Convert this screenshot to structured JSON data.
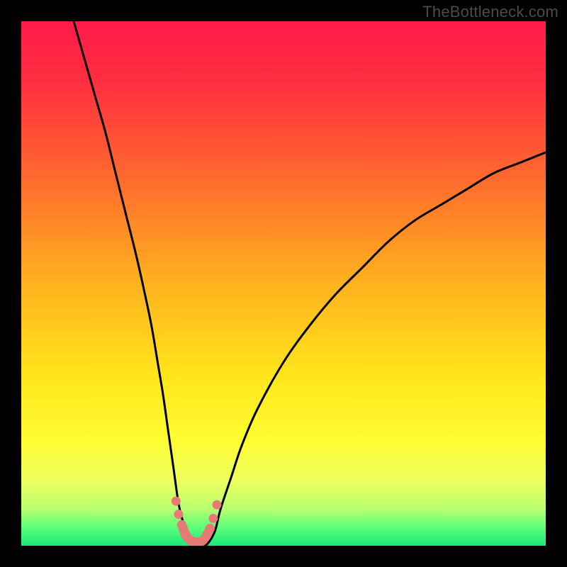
{
  "watermark": "TheBottleneck.com",
  "gradient_stops": [
    {
      "offset": 0.0,
      "color": "#ff1a4b"
    },
    {
      "offset": 0.12,
      "color": "#ff3040"
    },
    {
      "offset": 0.3,
      "color": "#ff6a2e"
    },
    {
      "offset": 0.5,
      "color": "#ffb21f"
    },
    {
      "offset": 0.68,
      "color": "#ffe61a"
    },
    {
      "offset": 0.8,
      "color": "#fffd33"
    },
    {
      "offset": 0.88,
      "color": "#eaff60"
    },
    {
      "offset": 0.93,
      "color": "#b8ff70"
    },
    {
      "offset": 0.965,
      "color": "#5cff79"
    },
    {
      "offset": 1.0,
      "color": "#19e879"
    }
  ],
  "curve_color": "#000000",
  "marker_color": "#e77a74",
  "chart_data": {
    "type": "line",
    "title": "",
    "xlabel": "",
    "ylabel": "",
    "xlim": [
      0,
      100
    ],
    "ylim": [
      0,
      100
    ],
    "series": [
      {
        "name": "bottleneck-curve",
        "x": [
          10,
          12,
          14,
          16,
          18,
          20,
          22,
          24,
          25,
          26,
          27,
          28,
          29,
          30,
          31,
          32,
          33,
          34,
          35,
          36,
          37,
          38,
          40,
          42,
          45,
          50,
          55,
          60,
          65,
          70,
          75,
          80,
          85,
          90,
          95,
          100
        ],
        "y": [
          100,
          93,
          86,
          79,
          71,
          63,
          55,
          46,
          41,
          35,
          29,
          22,
          15,
          8,
          4,
          1,
          0,
          0,
          0,
          1,
          3,
          7,
          13,
          19,
          26,
          35,
          42,
          48,
          53,
          58,
          62,
          65,
          68,
          71,
          73,
          75
        ]
      }
    ],
    "markers": {
      "name": "highlight-points",
      "x": [
        29.5,
        30.0,
        30.6,
        31.5,
        32.5,
        33.5,
        34.5,
        35.3,
        36.0,
        36.6,
        37.3
      ],
      "y": [
        8.5,
        6.0,
        4.0,
        1.8,
        0.9,
        0.7,
        0.9,
        1.9,
        3.3,
        5.2,
        7.8
      ]
    }
  }
}
